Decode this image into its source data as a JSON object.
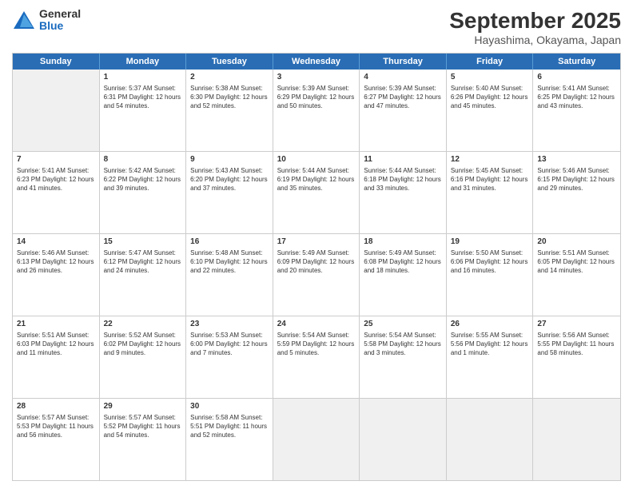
{
  "logo": {
    "general": "General",
    "blue": "Blue"
  },
  "title": {
    "month": "September 2025",
    "location": "Hayashima, Okayama, Japan"
  },
  "header_days": [
    "Sunday",
    "Monday",
    "Tuesday",
    "Wednesday",
    "Thursday",
    "Friday",
    "Saturday"
  ],
  "rows": [
    [
      {
        "day": "",
        "detail": ""
      },
      {
        "day": "1",
        "detail": "Sunrise: 5:37 AM\nSunset: 6:31 PM\nDaylight: 12 hours\nand 54 minutes."
      },
      {
        "day": "2",
        "detail": "Sunrise: 5:38 AM\nSunset: 6:30 PM\nDaylight: 12 hours\nand 52 minutes."
      },
      {
        "day": "3",
        "detail": "Sunrise: 5:39 AM\nSunset: 6:29 PM\nDaylight: 12 hours\nand 50 minutes."
      },
      {
        "day": "4",
        "detail": "Sunrise: 5:39 AM\nSunset: 6:27 PM\nDaylight: 12 hours\nand 47 minutes."
      },
      {
        "day": "5",
        "detail": "Sunrise: 5:40 AM\nSunset: 6:26 PM\nDaylight: 12 hours\nand 45 minutes."
      },
      {
        "day": "6",
        "detail": "Sunrise: 5:41 AM\nSunset: 6:25 PM\nDaylight: 12 hours\nand 43 minutes."
      }
    ],
    [
      {
        "day": "7",
        "detail": "Sunrise: 5:41 AM\nSunset: 6:23 PM\nDaylight: 12 hours\nand 41 minutes."
      },
      {
        "day": "8",
        "detail": "Sunrise: 5:42 AM\nSunset: 6:22 PM\nDaylight: 12 hours\nand 39 minutes."
      },
      {
        "day": "9",
        "detail": "Sunrise: 5:43 AM\nSunset: 6:20 PM\nDaylight: 12 hours\nand 37 minutes."
      },
      {
        "day": "10",
        "detail": "Sunrise: 5:44 AM\nSunset: 6:19 PM\nDaylight: 12 hours\nand 35 minutes."
      },
      {
        "day": "11",
        "detail": "Sunrise: 5:44 AM\nSunset: 6:18 PM\nDaylight: 12 hours\nand 33 minutes."
      },
      {
        "day": "12",
        "detail": "Sunrise: 5:45 AM\nSunset: 6:16 PM\nDaylight: 12 hours\nand 31 minutes."
      },
      {
        "day": "13",
        "detail": "Sunrise: 5:46 AM\nSunset: 6:15 PM\nDaylight: 12 hours\nand 29 minutes."
      }
    ],
    [
      {
        "day": "14",
        "detail": "Sunrise: 5:46 AM\nSunset: 6:13 PM\nDaylight: 12 hours\nand 26 minutes."
      },
      {
        "day": "15",
        "detail": "Sunrise: 5:47 AM\nSunset: 6:12 PM\nDaylight: 12 hours\nand 24 minutes."
      },
      {
        "day": "16",
        "detail": "Sunrise: 5:48 AM\nSunset: 6:10 PM\nDaylight: 12 hours\nand 22 minutes."
      },
      {
        "day": "17",
        "detail": "Sunrise: 5:49 AM\nSunset: 6:09 PM\nDaylight: 12 hours\nand 20 minutes."
      },
      {
        "day": "18",
        "detail": "Sunrise: 5:49 AM\nSunset: 6:08 PM\nDaylight: 12 hours\nand 18 minutes."
      },
      {
        "day": "19",
        "detail": "Sunrise: 5:50 AM\nSunset: 6:06 PM\nDaylight: 12 hours\nand 16 minutes."
      },
      {
        "day": "20",
        "detail": "Sunrise: 5:51 AM\nSunset: 6:05 PM\nDaylight: 12 hours\nand 14 minutes."
      }
    ],
    [
      {
        "day": "21",
        "detail": "Sunrise: 5:51 AM\nSunset: 6:03 PM\nDaylight: 12 hours\nand 11 minutes."
      },
      {
        "day": "22",
        "detail": "Sunrise: 5:52 AM\nSunset: 6:02 PM\nDaylight: 12 hours\nand 9 minutes."
      },
      {
        "day": "23",
        "detail": "Sunrise: 5:53 AM\nSunset: 6:00 PM\nDaylight: 12 hours\nand 7 minutes."
      },
      {
        "day": "24",
        "detail": "Sunrise: 5:54 AM\nSunset: 5:59 PM\nDaylight: 12 hours\nand 5 minutes."
      },
      {
        "day": "25",
        "detail": "Sunrise: 5:54 AM\nSunset: 5:58 PM\nDaylight: 12 hours\nand 3 minutes."
      },
      {
        "day": "26",
        "detail": "Sunrise: 5:55 AM\nSunset: 5:56 PM\nDaylight: 12 hours\nand 1 minute."
      },
      {
        "day": "27",
        "detail": "Sunrise: 5:56 AM\nSunset: 5:55 PM\nDaylight: 11 hours\nand 58 minutes."
      }
    ],
    [
      {
        "day": "28",
        "detail": "Sunrise: 5:57 AM\nSunset: 5:53 PM\nDaylight: 11 hours\nand 56 minutes."
      },
      {
        "day": "29",
        "detail": "Sunrise: 5:57 AM\nSunset: 5:52 PM\nDaylight: 11 hours\nand 54 minutes."
      },
      {
        "day": "30",
        "detail": "Sunrise: 5:58 AM\nSunset: 5:51 PM\nDaylight: 11 hours\nand 52 minutes."
      },
      {
        "day": "",
        "detail": ""
      },
      {
        "day": "",
        "detail": ""
      },
      {
        "day": "",
        "detail": ""
      },
      {
        "day": "",
        "detail": ""
      }
    ]
  ]
}
